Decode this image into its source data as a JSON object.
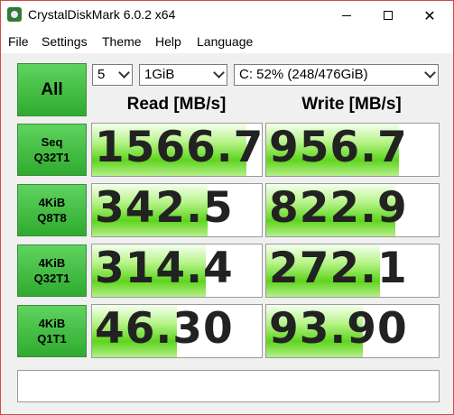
{
  "window": {
    "title": "CrystalDiskMark 6.0.2 x64",
    "close_glyph": "✕"
  },
  "menu": [
    "File",
    "Settings",
    "Theme",
    "Help",
    "Language"
  ],
  "controls": {
    "all_label": "All",
    "count": "5",
    "size": "1GiB",
    "drive": "C: 52% (248/476GiB)"
  },
  "headers": {
    "read": "Read [MB/s]",
    "write": "Write [MB/s]"
  },
  "tests": [
    {
      "line1": "Seq",
      "line2": "Q32T1",
      "read": "1566.7",
      "write": "956.7",
      "read_fill": 0.91,
      "write_fill": 0.77
    },
    {
      "line1": "4KiB",
      "line2": "Q8T8",
      "read": "342.5",
      "write": "822.9",
      "read_fill": 0.68,
      "write_fill": 0.75
    },
    {
      "line1": "4KiB",
      "line2": "Q32T1",
      "read": "314.4",
      "write": "272.1",
      "read_fill": 0.67,
      "write_fill": 0.66
    },
    {
      "line1": "4KiB",
      "line2": "Q1T1",
      "read": "46.30",
      "write": "93.90",
      "read_fill": 0.5,
      "write_fill": 0.56
    }
  ],
  "comment": ""
}
